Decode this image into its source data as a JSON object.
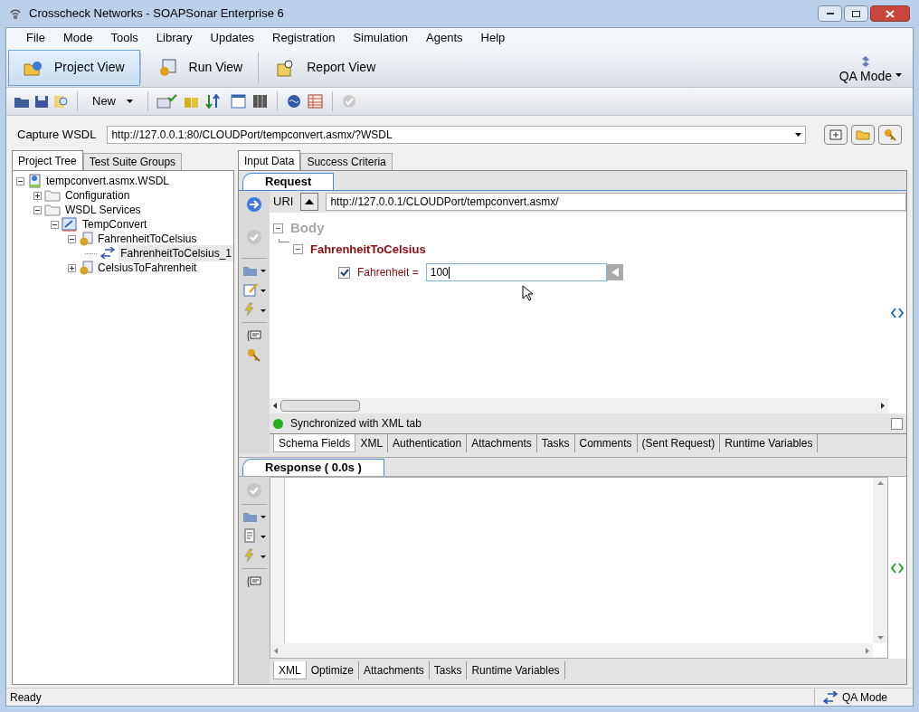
{
  "window": {
    "title": "Crosscheck Networks - SOAPSonar Enterprise 6"
  },
  "menu": [
    "File",
    "Mode",
    "Tools",
    "Library",
    "Updates",
    "Registration",
    "Simulation",
    "Agents",
    "Help"
  ],
  "view_tabs": [
    {
      "label": "Project View",
      "selected": true
    },
    {
      "label": "Run View",
      "selected": false
    },
    {
      "label": "Report View",
      "selected": false
    }
  ],
  "mode_button": "QA Mode",
  "toolbar": {
    "new_button": "New"
  },
  "capture": {
    "label": "Capture WSDL",
    "value": "http://127.0.0.1:80/CLOUDPort/tempconvert.asmx/?WSDL"
  },
  "left_tabs": [
    {
      "label": "Project Tree",
      "selected": true
    },
    {
      "label": "Test Suite Groups",
      "selected": false
    }
  ],
  "tree": [
    {
      "label": "tempconvert.asmx.WSDL",
      "kind": "wsdl",
      "expanded": true,
      "selected": false,
      "children": [
        {
          "label": "Configuration",
          "kind": "folder",
          "expanded": false,
          "selected": false
        },
        {
          "label": "WSDL Services",
          "kind": "folder",
          "expanded": true,
          "selected": false,
          "children": [
            {
              "label": "TempConvert",
              "kind": "service",
              "expanded": true,
              "selected": false,
              "children": [
                {
                  "label": "FahrenheitToCelsius",
                  "kind": "operation",
                  "expanded": true,
                  "selected": false,
                  "children": [
                    {
                      "label": "FahrenheitToCelsius_1",
                      "kind": "request",
                      "selected": true
                    }
                  ]
                },
                {
                  "label": "CelsiusToFahrenheit",
                  "kind": "operation",
                  "expanded": false,
                  "selected": false
                }
              ]
            }
          ]
        }
      ]
    }
  ],
  "right_tabs": [
    {
      "label": "Input Data",
      "selected": true
    },
    {
      "label": "Success Criteria",
      "selected": false
    }
  ],
  "request": {
    "tab": "Request",
    "uri_label": "URI",
    "uri": "http://127.0.0.1/CLOUDPort/tempconvert.asmx/",
    "body_label": "Body",
    "operation": "FahrenheitToCelsius",
    "field": {
      "label": "Fahrenheit =",
      "checked": true,
      "value": "100"
    },
    "sync_status": "Synchronized with XML tab",
    "sync_checkbox": {
      "checked": false
    },
    "tabs": [
      {
        "label": "Schema Fields",
        "selected": true
      },
      {
        "label": "XML",
        "selected": false
      },
      {
        "label": "Authentication",
        "selected": false
      },
      {
        "label": "Attachments",
        "selected": false
      },
      {
        "label": "Tasks",
        "selected": false
      },
      {
        "label": "Comments",
        "selected": false
      },
      {
        "label": "(Sent Request)",
        "selected": false
      },
      {
        "label": "Runtime Variables",
        "selected": false
      }
    ]
  },
  "response": {
    "tab": "Response ( 0.0s )",
    "tabs": [
      {
        "label": "XML",
        "selected": true
      },
      {
        "label": "Optimize",
        "selected": false
      },
      {
        "label": "Attachments",
        "selected": false
      },
      {
        "label": "Tasks",
        "selected": false
      },
      {
        "label": "Runtime Variables",
        "selected": false
      }
    ]
  },
  "status_bar": {
    "text": "Ready",
    "mode": "QA Mode"
  }
}
